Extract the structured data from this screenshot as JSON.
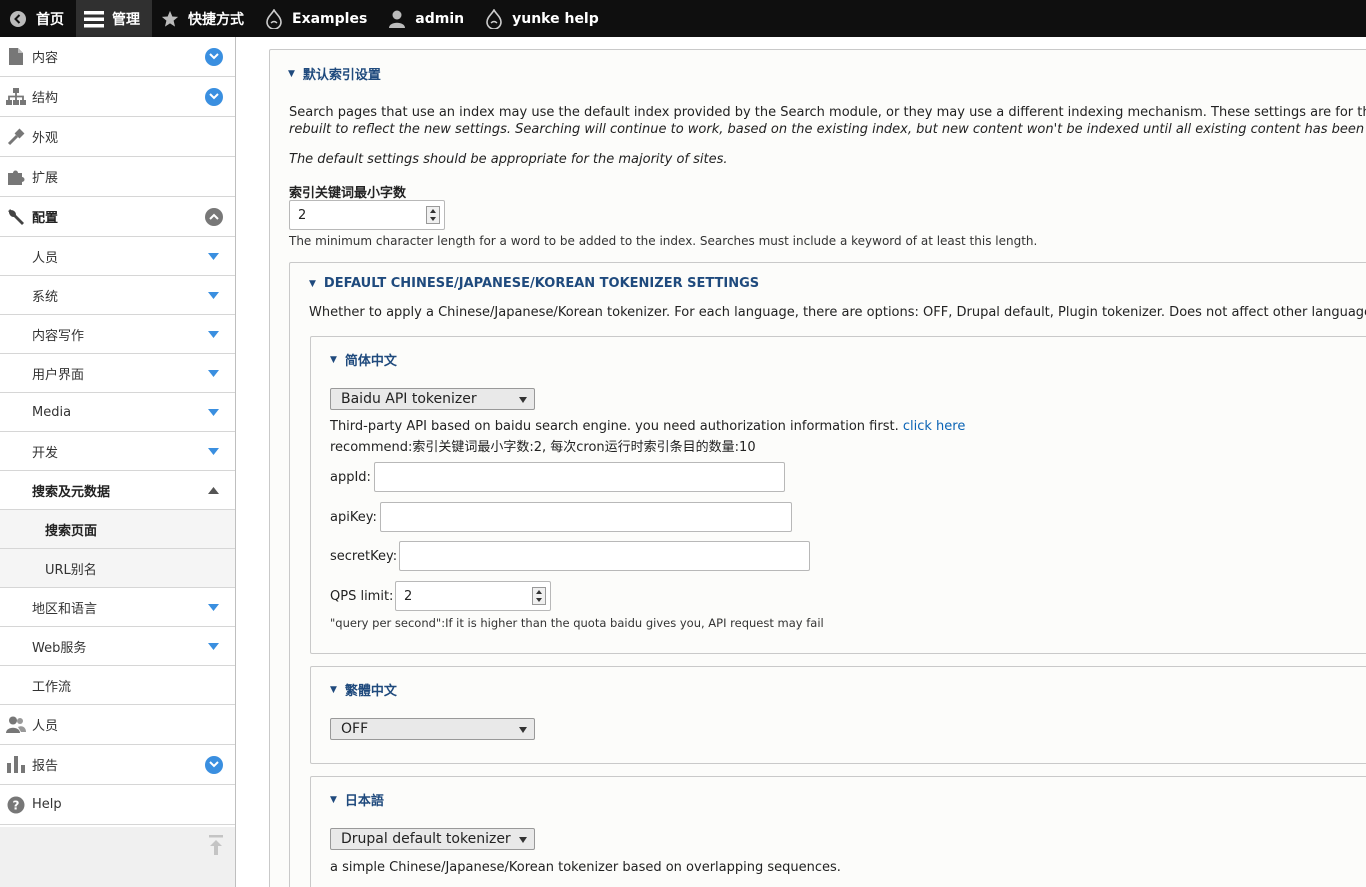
{
  "toolbar": {
    "items": [
      {
        "label": "首页",
        "icon": "back-circle-icon"
      },
      {
        "label": "管理",
        "icon": "hamburger-icon"
      },
      {
        "label": "快捷方式",
        "icon": "star-icon"
      },
      {
        "label": "Examples",
        "icon": "drupal-drop-icon"
      },
      {
        "label": "admin",
        "icon": "user-icon"
      },
      {
        "label": "yunke help",
        "icon": "drupal-drop-icon"
      }
    ]
  },
  "sidebar": {
    "content": "内容",
    "structure": "结构",
    "appearance": "外观",
    "extend": "扩展",
    "config": "配置",
    "people_sub": "人员",
    "system": "系统",
    "content_authoring": "内容写作",
    "user_interface": "用户界面",
    "media": "Media",
    "development": "开发",
    "search_meta": "搜索及元数据",
    "search_pages": "搜索页面",
    "url_alias": "URL别名",
    "region_language": "地区和语言",
    "web_services": "Web服务",
    "workflow": "工作流",
    "people": "人员",
    "reports": "报告",
    "help": "Help"
  },
  "main": {
    "default_index": {
      "legend": "默认索引设置",
      "desc_line1": "Search pages that use an index may use the default index provided by the Search module, or they may use a different indexing mechanism. These settings are for the defa",
      "desc_line2": "rebuilt to reflect the new settings. Searching will continue to work, based on the existing index, but new content won't be indexed until all existing content has been re-in",
      "desc_line3": "The default settings should be appropriate for the majority of sites.",
      "min_len_label": "索引关键词最小字数",
      "min_len_value": "2",
      "min_len_help": "The minimum character length for a word to be added to the index. Searches must include a keyword of at least this length."
    },
    "cjk": {
      "legend": "DEFAULT CHINESE/JAPANESE/KOREAN TOKENIZER SETTINGS",
      "desc": "Whether to apply a Chinese/Japanese/Korean tokenizer. For each language, there are options: OFF, Drupal default, Plugin tokenizer. Does not affect other languages.",
      "simplified": {
        "legend": "简体中文",
        "select": "Baidu API tokenizer",
        "desc": "Third-party API based on baidu search engine. you need authorization information first.",
        "link": "click here",
        "recommend": "recommend:索引关键词最小字数:2, 每次cron运行时索引条目的数量:10",
        "appid_label": "appId:",
        "apikey_label": "apiKey:",
        "secretkey_label": "secretKey:",
        "qps_label": "QPS limit:",
        "qps_value": "2",
        "qps_help": "\"query per second\":If it is higher than the quota baidu gives you, API request may fail"
      },
      "traditional": {
        "legend": "繁體中文",
        "select": "OFF"
      },
      "japanese": {
        "legend": "日本語",
        "select": "Drupal default tokenizer",
        "desc": "a simple Chinese/Japanese/Korean tokenizer based on overlapping sequences."
      }
    }
  },
  "colors": {
    "toolbar_bg": "#0f0f0f",
    "legend": "#1f4a7d",
    "link": "#0a63b5",
    "expand_circle": "#3a8fe0"
  }
}
